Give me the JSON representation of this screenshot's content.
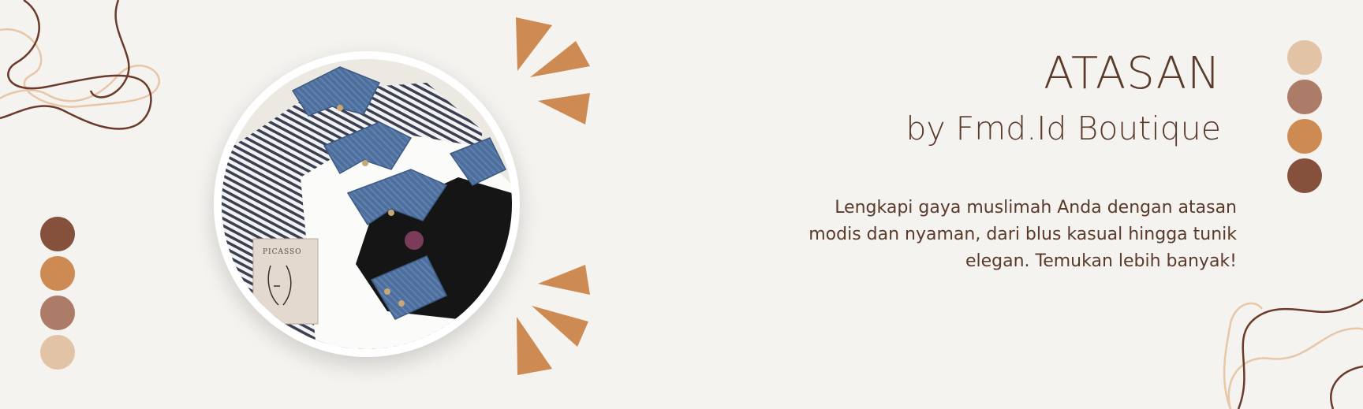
{
  "banner": {
    "title": "ATASAN",
    "subtitle": "by Fmd.Id Boutique",
    "description": "Lengkapi gaya muslimah Anda dengan atasan modis dan nyaman, dari blus kasual hingga tunik elegan. Temukan lebih banyak!"
  },
  "photo": {
    "book_label": "PICASSO"
  },
  "colors": {
    "background": "#f5f3ef",
    "text": "#5a3a2a",
    "accent": "#cd8a52",
    "swatch_1": "#e2c3a6",
    "swatch_2": "#ac7c69",
    "swatch_3": "#cd8a52",
    "swatch_4": "#85513d"
  },
  "icons": {
    "sunburst": "sunburst-ray-icon",
    "squiggle": "squiggle-line-icon"
  }
}
